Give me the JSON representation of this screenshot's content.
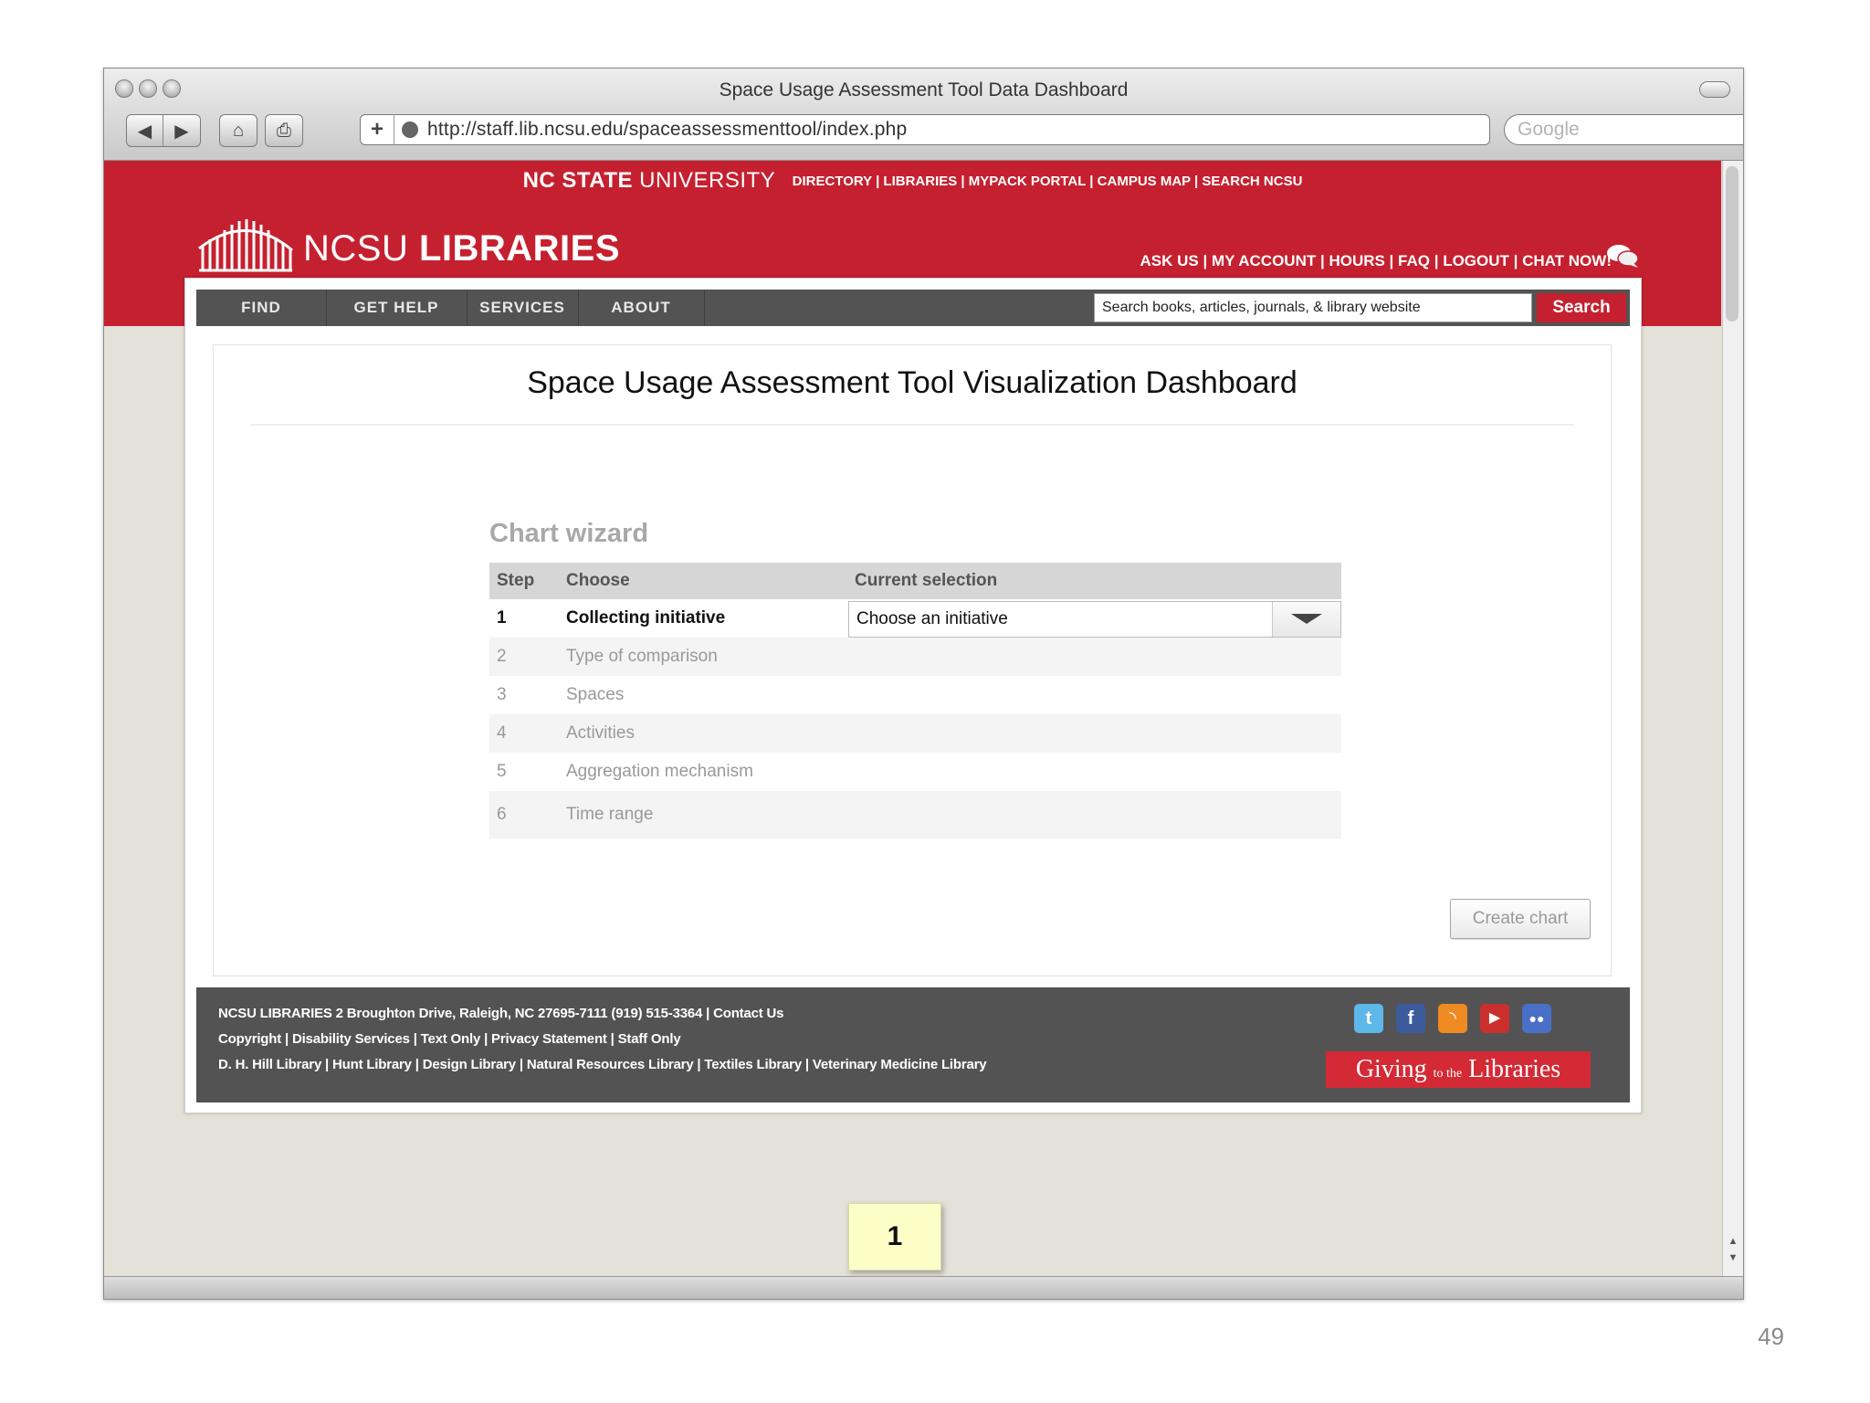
{
  "window": {
    "title": "Space Usage Assessment Tool Data Dashboard",
    "url": "http://staff.lib.ncsu.edu/spaceassessmenttool/index.php",
    "search_placeholder": "Google"
  },
  "site": {
    "university_bold": "NC STATE",
    "university_light": " UNIVERSITY",
    "top_links": "DIRECTORY | LIBRARIES | MYPACK PORTAL | CAMPUS MAP | SEARCH NCSU",
    "logo_light": "NCSU ",
    "logo_bold": "LIBRARIES",
    "account_links": "ASK US | MY ACCOUNT | HOURS | FAQ | LOGOUT | CHAT NOW!",
    "menu": [
      "FIND",
      "GET HELP",
      "SERVICES",
      "ABOUT"
    ],
    "search_text": "Search books, articles, journals, & library website",
    "search_button": "Search",
    "brand_red": "#c5202f"
  },
  "dashboard": {
    "title": "Space Usage Assessment Tool Visualization Dashboard",
    "wizard_heading": "Chart wizard",
    "columns": [
      "Step",
      "Choose",
      "Current selection"
    ],
    "steps": [
      {
        "num": "1",
        "label": "Collecting initiative"
      },
      {
        "num": "2",
        "label": "Type of comparison"
      },
      {
        "num": "3",
        "label": "Spaces"
      },
      {
        "num": "4",
        "label": "Activities"
      },
      {
        "num": "5",
        "label": "Aggregation mechanism"
      },
      {
        "num": "6",
        "label": "Time range"
      }
    ],
    "initiative_select": "Choose an initiative",
    "create_chart": "Create chart"
  },
  "footer": {
    "org": "NCSU LIBRARIES",
    "address": " 2 Broughton Drive, Raleigh, NC 27695-7111 (919) 515-3364 | Contact Us",
    "line2": "Copyright | Disability Services | Text Only | Privacy Statement | Staff Only",
    "line3": "D. H. Hill Library | Hunt Library | Design Library | Natural Resources Library | Textiles Library | Veterinary Medicine Library",
    "giving_a": "Giving ",
    "giving_b": "to the",
    "giving_c": " Libraries",
    "social_icons": [
      "twitter-icon",
      "facebook-icon",
      "rss-icon",
      "youtube-icon",
      "flickr-icon"
    ]
  },
  "page_marker": "1",
  "slide_number": "49"
}
